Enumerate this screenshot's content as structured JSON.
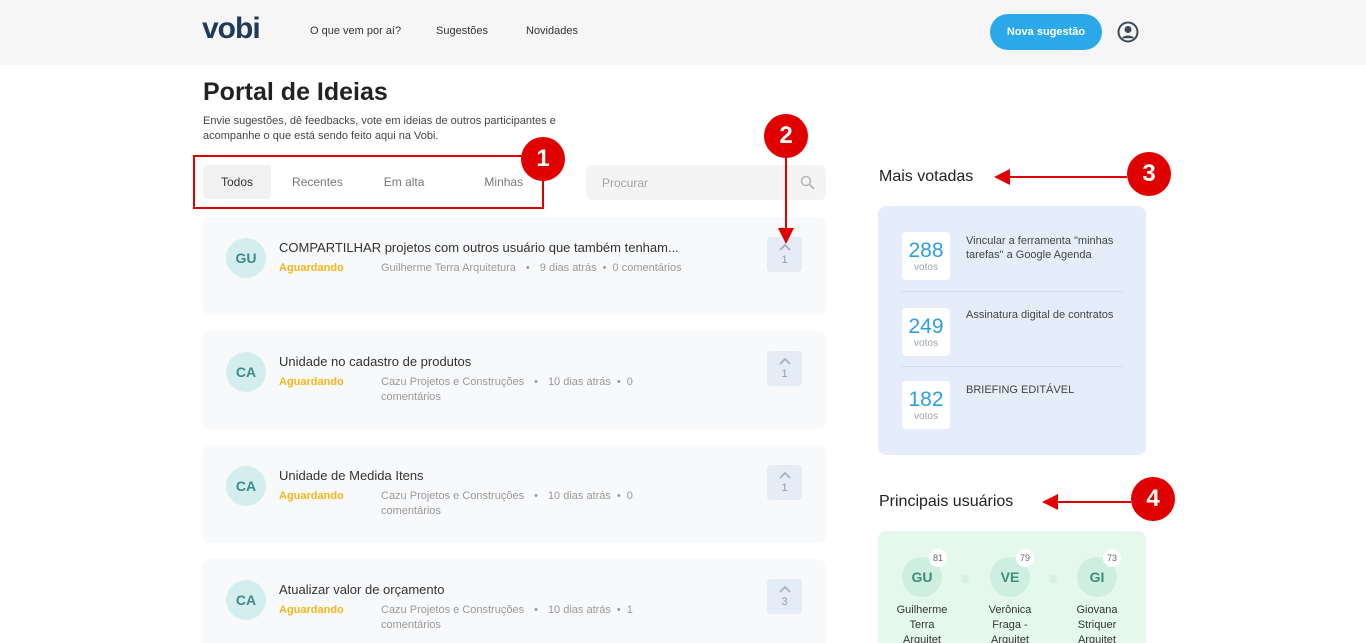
{
  "header": {
    "logo": "vobi",
    "nav": [
      "O que vem por aí?",
      "Sugestões",
      "Novidades"
    ],
    "new_button": "Nova sugestão"
  },
  "page": {
    "title": "Portal de Ideias",
    "subtitle": "Envie sugestões, dê feedbacks, vote em ideias de outros participantes e acompanhe o que está sendo feito aqui na Vobi."
  },
  "tabs": [
    "Todos",
    "Recentes",
    "Em alta",
    "Minhas"
  ],
  "search": {
    "placeholder": "Procurar"
  },
  "ideas": [
    {
      "initials": "GU",
      "title": "COMPARTILHAR projetos com outros usuário que também tenham...",
      "status": "Aguardando",
      "author": "Guilherme Terra Arquitetura",
      "time": "9 dias atrás",
      "comments": "0",
      "comments_label": "comentários",
      "votes": "1"
    },
    {
      "initials": "CA",
      "title": "Unidade no cadastro de produtos",
      "status": "Aguardando",
      "author": "Cazu Projetos e Construções",
      "time": "10 dias atrás",
      "comments": "0",
      "comments_label": "comentários",
      "votes": "1"
    },
    {
      "initials": "CA",
      "title": "Unidade de Medida Itens",
      "status": "Aguardando",
      "author": "Cazu Projetos e Construções",
      "time": "10 dias atrás",
      "comments": "0",
      "comments_label": "comentários",
      "votes": "1"
    },
    {
      "initials": "CA",
      "title": "Atualizar valor de orçamento",
      "status": "Aguardando",
      "author": "Cazu Projetos e Construções",
      "time": "10 dias atrás",
      "comments": "1",
      "comments_label": "comentários",
      "votes": "3"
    }
  ],
  "mais_votadas": {
    "title": "Mais votadas",
    "votes_label": "votos",
    "items": [
      {
        "votes": "288",
        "text": "Vincular a ferramenta \"minhas tarefas\" a Google Agenda"
      },
      {
        "votes": "249",
        "text": "Assinatura digital de contratos"
      },
      {
        "votes": "182",
        "text": "BRIEFING EDITÁVEL"
      }
    ]
  },
  "principais_usuarios": {
    "title": "Principais usuários",
    "users": [
      {
        "initials": "GU",
        "score": "81",
        "name": "Guilherme Terra Arquitet"
      },
      {
        "initials": "VE",
        "score": "79",
        "name": "Verônica Fraga - Arquitet"
      },
      {
        "initials": "GI",
        "score": "73",
        "name": "Giovana Striquer Arquitet"
      }
    ]
  },
  "annotations": [
    "1",
    "2",
    "3",
    "4"
  ],
  "colors": {
    "accent": "#2aa8e9",
    "status": "#f5b61b",
    "annotation": "#e10000"
  }
}
